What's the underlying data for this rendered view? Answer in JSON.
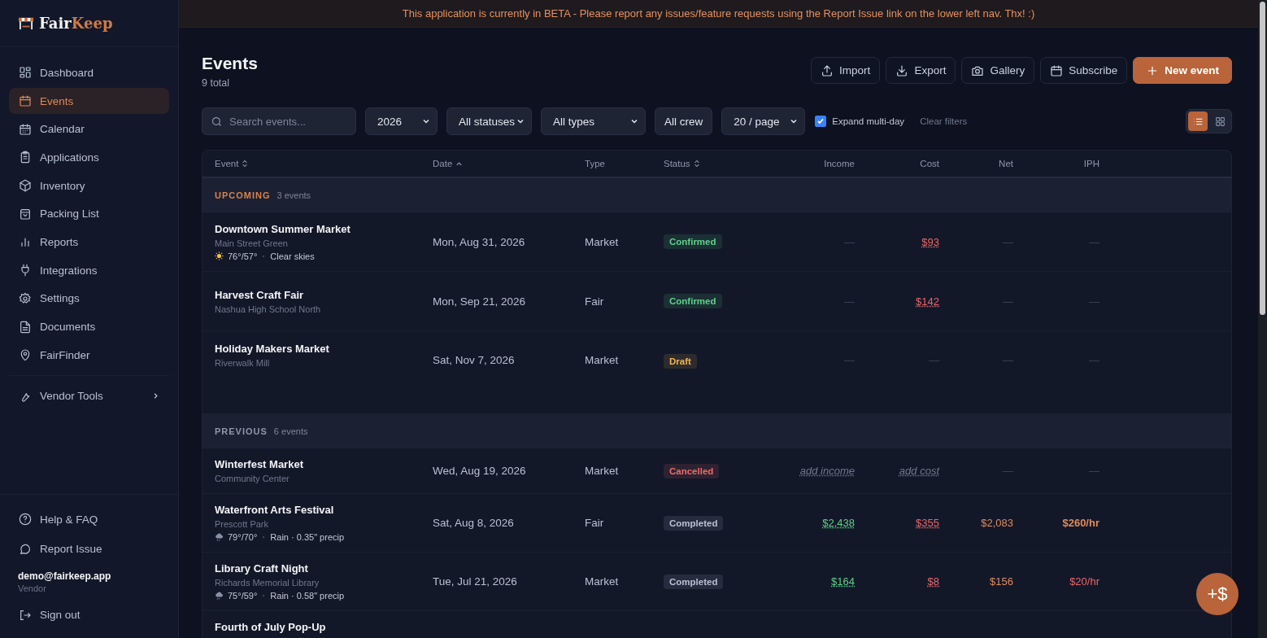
{
  "banner": "This application is currently in BETA - Please report any issues/feature requests using the Report Issue link on the lower left nav. Thx! :)",
  "brand": {
    "first": "Fair",
    "second": "Keep"
  },
  "nav": [
    {
      "label": "Dashboard",
      "kind": "grid",
      "selected": false
    },
    {
      "label": "Events",
      "kind": "calendar",
      "selected": true
    },
    {
      "label": "Calendar",
      "kind": "planner",
      "selected": false
    },
    {
      "label": "Applications",
      "kind": "clipboard",
      "selected": false
    },
    {
      "label": "Inventory",
      "kind": "box",
      "selected": false
    },
    {
      "label": "Packing List",
      "kind": "bag",
      "selected": false
    },
    {
      "label": "Reports",
      "kind": "bars",
      "selected": false
    },
    {
      "label": "Integrations",
      "kind": "plug",
      "selected": false
    },
    {
      "label": "Settings",
      "kind": "gear",
      "selected": false
    },
    {
      "label": "Documents",
      "kind": "doc",
      "selected": false
    },
    {
      "label": "FairFinder",
      "kind": "pin",
      "selected": false
    }
  ],
  "vendor_tools": {
    "label": "Vendor Tools"
  },
  "footer_links": [
    {
      "label": "Help & FAQ",
      "kind": "help"
    },
    {
      "label": "Report Issue",
      "kind": "chat"
    }
  ],
  "user": {
    "email": "demo@fairkeep.app",
    "role": "Vendor"
  },
  "sign_out": "Sign out",
  "page": {
    "title": "Events",
    "subtitle": "9 total"
  },
  "actions": [
    {
      "label": "Import",
      "kind": "upload"
    },
    {
      "label": "Export",
      "kind": "download"
    },
    {
      "label": "Gallery",
      "kind": "camera"
    },
    {
      "label": "Subscribe",
      "kind": "calendar"
    },
    {
      "label": "New event",
      "kind": "plus"
    }
  ],
  "filters": {
    "search": {
      "placeholder": "Search events..."
    },
    "controls": [
      {
        "value": "2026",
        "kind": "select"
      },
      {
        "value": "All statuses",
        "kind": "select"
      },
      {
        "value": "All types",
        "kind": "select"
      },
      {
        "value": "All crew",
        "kind": "button"
      },
      {
        "value": "20 / page",
        "kind": "select"
      }
    ],
    "expand_multi_day": {
      "label": "Expand multi-day",
      "checked": true
    },
    "clear": "Clear filters",
    "views": [
      {
        "kind": "list",
        "selected": true
      },
      {
        "kind": "grid",
        "selected": false
      }
    ]
  },
  "table": {
    "columns": [
      {
        "label": "Event",
        "sorted": false
      },
      {
        "label": "Date",
        "sorted": true
      },
      {
        "label": "Type"
      },
      {
        "label": "Status",
        "sorted": false
      },
      {
        "label": "Income"
      },
      {
        "label": "Cost"
      },
      {
        "label": "Net"
      },
      {
        "label": "IPH"
      }
    ],
    "groups": [
      {
        "label": "UPCOMING",
        "count": "3 events",
        "color": "#d9834f",
        "rows": [
          {
            "name": "Downtown Summer Market",
            "venue": "Main Street Green",
            "weather": {
              "kind": "sun",
              "temp": "76°/57°",
              "condition": "Clear skies"
            },
            "date": "Mon, Aug 31, 2026",
            "type": "Market",
            "status": {
              "label": "Confirmed",
              "color": "#5ed28a"
            },
            "income": {
              "text": "—",
              "kind": "blank"
            },
            "cost": {
              "text": "$93",
              "kind": "amount",
              "color": "#e9676a"
            },
            "net": {
              "text": "—",
              "kind": "blank"
            },
            "iph": {
              "text": "—",
              "kind": "blank"
            }
          },
          {
            "name": "Harvest Craft Fair",
            "venue": "Nashua High School North",
            "date": "Mon, Sep 21, 2026",
            "type": "Fair",
            "status": {
              "label": "Confirmed",
              "color": "#5ed28a"
            },
            "income": {
              "text": "—",
              "kind": "blank"
            },
            "cost": {
              "text": "$142",
              "kind": "amount",
              "color": "#e9676a"
            },
            "net": {
              "text": "—",
              "kind": "blank"
            },
            "iph": {
              "text": "—",
              "kind": "blank"
            }
          },
          {
            "name": "Holiday Makers Market",
            "venue": "Riverwalk Mill",
            "date": "Sat, Nov 7, 2026",
            "type": "Market",
            "status": {
              "label": "Draft",
              "color": "#f0b64b"
            },
            "income": {
              "text": "—",
              "kind": "blank"
            },
            "cost": {
              "text": "—",
              "kind": "blank"
            },
            "net": {
              "text": "—",
              "kind": "blank"
            },
            "iph": {
              "text": "—",
              "kind": "blank"
            }
          }
        ]
      },
      {
        "label": "PREVIOUS",
        "count": "6 events",
        "color": "#8e97a9",
        "rows": [
          {
            "name": "Winterfest Market",
            "venue": "Community Center",
            "date": "Wed, Aug 19, 2026",
            "type": "Market",
            "status": {
              "label": "Cancelled",
              "color": "#f06a6a"
            },
            "income": {
              "text": "add income",
              "kind": "prompt"
            },
            "cost": {
              "text": "add cost",
              "kind": "prompt"
            },
            "net": {
              "text": "—",
              "kind": "blank"
            },
            "iph": {
              "text": "—",
              "kind": "blank"
            }
          },
          {
            "name": "Waterfront Arts Festival",
            "venue": "Prescott Park",
            "weather": {
              "kind": "rain",
              "temp": "79°/70°",
              "condition": "Rain · 0.35\" precip"
            },
            "date": "Sat, Aug 8, 2026",
            "type": "Fair",
            "status": {
              "label": "Completed",
              "color": "#b7c0d2"
            },
            "income": {
              "text": "$2,438",
              "kind": "amount",
              "color": "#5ed28a"
            },
            "cost": {
              "text": "$355",
              "kind": "amount",
              "color": "#e9676a"
            },
            "net": {
              "text": "$2,083",
              "kind": "amount",
              "color": "#df8c5a"
            },
            "iph": {
              "text": "$260/hr",
              "kind": "bold",
              "color": "#df8c5a"
            }
          },
          {
            "name": "Library Craft Night",
            "venue": "Richards Memorial Library",
            "weather": {
              "kind": "rain",
              "temp": "75°/59°",
              "condition": "Rain · 0.58\" precip"
            },
            "date": "Tue, Jul 21, 2026",
            "type": "Market",
            "status": {
              "label": "Completed",
              "color": "#b7c0d2"
            },
            "income": {
              "text": "$164",
              "kind": "amount",
              "color": "#5ed28a"
            },
            "cost": {
              "text": "$8",
              "kind": "amount",
              "color": "#e9676a"
            },
            "net": {
              "text": "$156",
              "kind": "amount",
              "color": "#df8c5a"
            },
            "iph": {
              "text": "$20/hr",
              "kind": "amount",
              "color": "#e9676a"
            }
          },
          {
            "name": "Fourth of July Pop-Up"
          }
        ]
      }
    ]
  },
  "fab": "+$"
}
